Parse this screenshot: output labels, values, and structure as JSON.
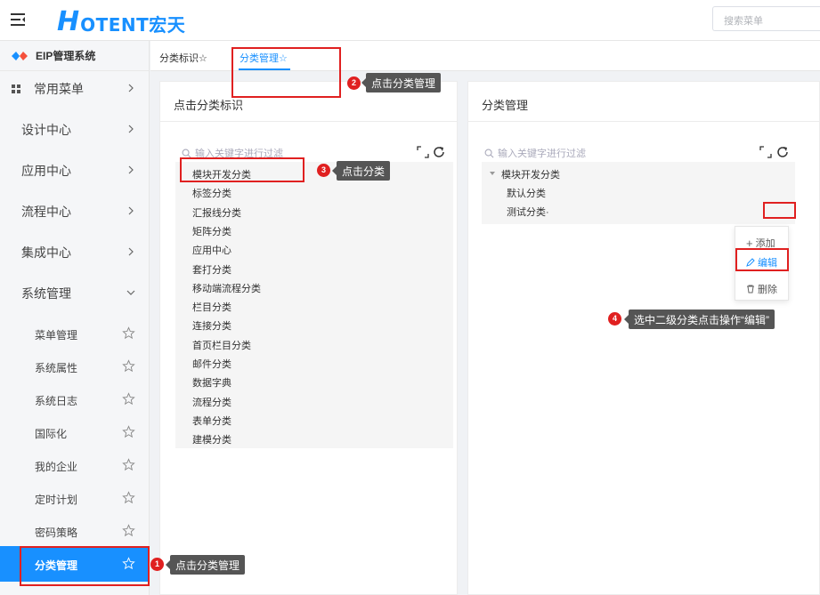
{
  "header": {
    "logo_big": "H",
    "logo_rest": "OTENT宏天",
    "search_placeholder": "搜索菜单"
  },
  "sidebar": {
    "system_title": "EIP管理系统",
    "level1": [
      {
        "label": "常用菜单",
        "expanded": false
      },
      {
        "label": "设计中心",
        "expanded": false
      },
      {
        "label": "应用中心",
        "expanded": false
      },
      {
        "label": "流程中心",
        "expanded": false
      },
      {
        "label": "集成中心",
        "expanded": false
      },
      {
        "label": "系统管理",
        "expanded": true
      }
    ],
    "level2": [
      {
        "label": "菜单管理",
        "active": false
      },
      {
        "label": "系统属性",
        "active": false
      },
      {
        "label": "系统日志",
        "active": false
      },
      {
        "label": "国际化",
        "active": false
      },
      {
        "label": "我的企业",
        "active": false
      },
      {
        "label": "定时计划",
        "active": false
      },
      {
        "label": "密码策略",
        "active": false
      },
      {
        "label": "分类管理",
        "active": true
      }
    ]
  },
  "tabs": [
    {
      "label": "分类标识☆",
      "active": false
    },
    {
      "label": "分类管理☆",
      "active": true
    }
  ],
  "left_panel": {
    "title": "点击分类标识",
    "filter_placeholder": "输入关键字进行过滤",
    "items": [
      "模块开发分类",
      "标签分类",
      "汇报线分类",
      "矩阵分类",
      "应用中心",
      "套打分类",
      "移动端流程分类",
      "栏目分类",
      "连接分类",
      "首页栏目分类",
      "邮件分类",
      "数据字典",
      "流程分类",
      "表单分类",
      "建模分类"
    ]
  },
  "right_panel": {
    "title": "分类管理",
    "filter_placeholder": "输入关键字进行过滤",
    "root": "模块开发分类",
    "children": [
      "默认分类",
      "测试分类·"
    ]
  },
  "context_menu": {
    "add": "添加",
    "edit": "编辑",
    "delete": "删除"
  },
  "annotations": [
    {
      "num": "1",
      "text": "点击分类管理"
    },
    {
      "num": "2",
      "text": "点击分类管理"
    },
    {
      "num": "3",
      "text": "点击分类"
    },
    {
      "num": "4",
      "text": "选中二级分类点击操作“编辑”"
    }
  ],
  "colors": {
    "accent": "#1890ff",
    "annotation_red": "#e02020",
    "callout_bg": "#555555"
  }
}
